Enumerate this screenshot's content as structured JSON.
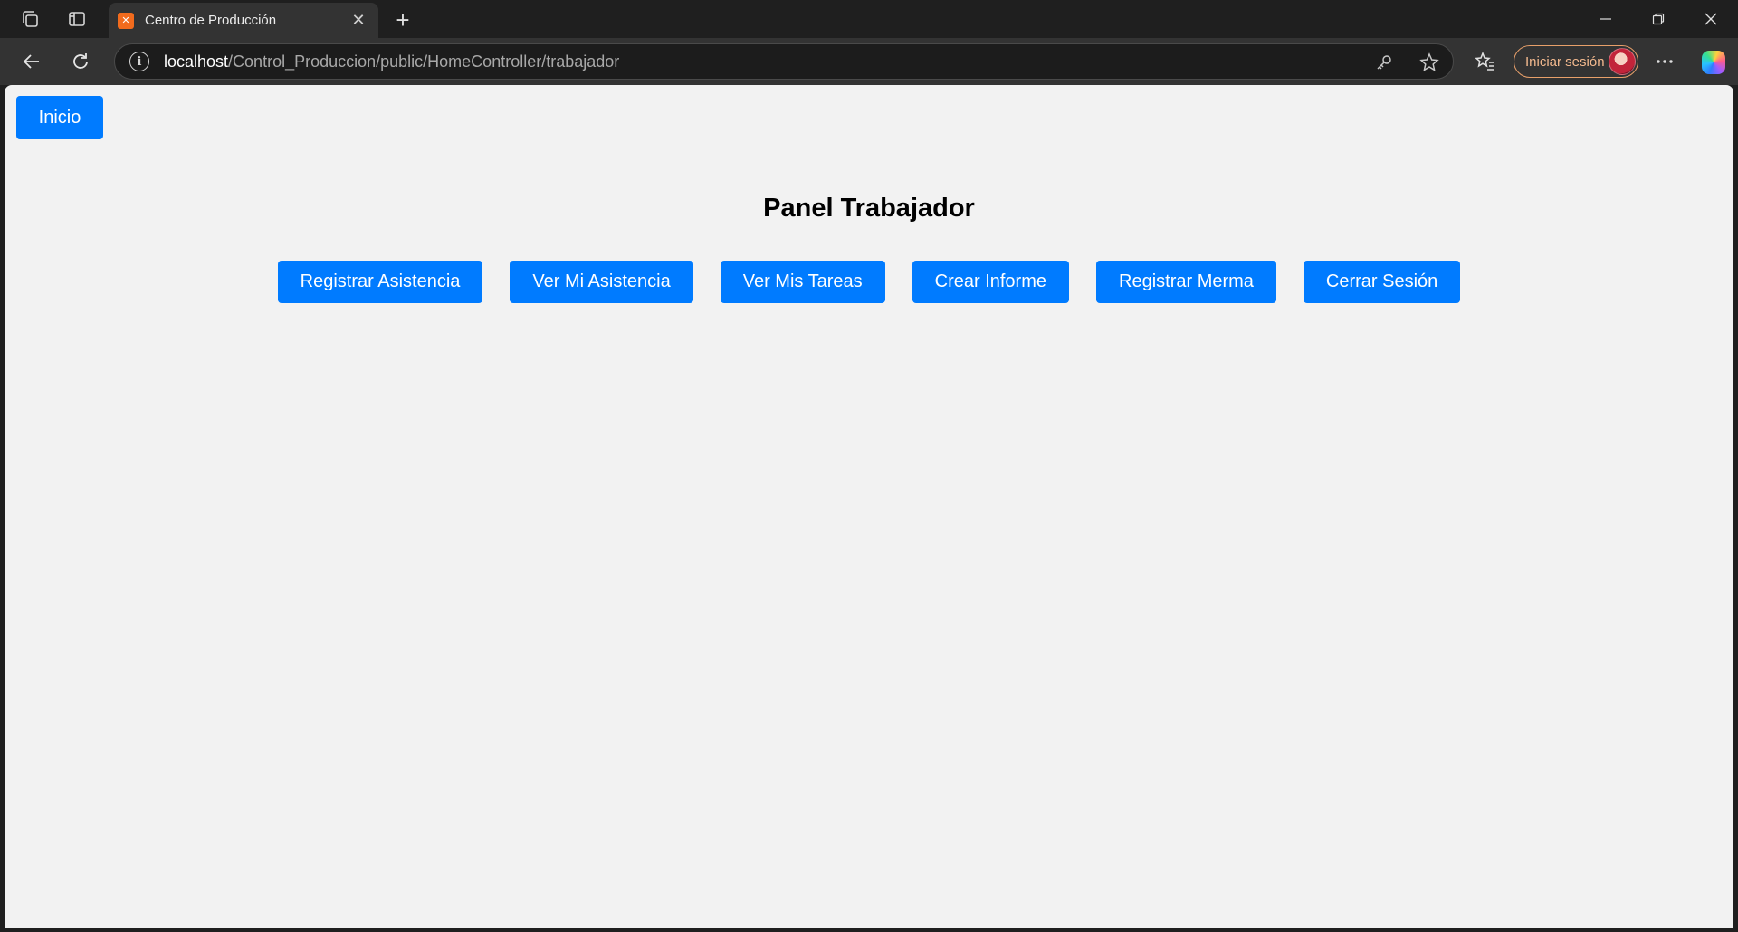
{
  "browser": {
    "tab": {
      "favicon": "xampp-favicon",
      "title": "Centro de Producción"
    },
    "address": {
      "host": "localhost",
      "path": "/Control_Produccion/public/HomeController/trabajador"
    },
    "signin_label": "Iniciar sesión"
  },
  "page": {
    "home_button": "Inicio",
    "title": "Panel Trabajador",
    "actions": [
      "Registrar Asistencia",
      "Ver Mi Asistencia",
      "Ver Mis Tareas",
      "Crear Informe",
      "Registrar Merma",
      "Cerrar Sesión"
    ]
  },
  "colors": {
    "primary_button": "#007bff",
    "page_background": "#f2f2f2",
    "browser_frame": "#1f1f1f"
  }
}
